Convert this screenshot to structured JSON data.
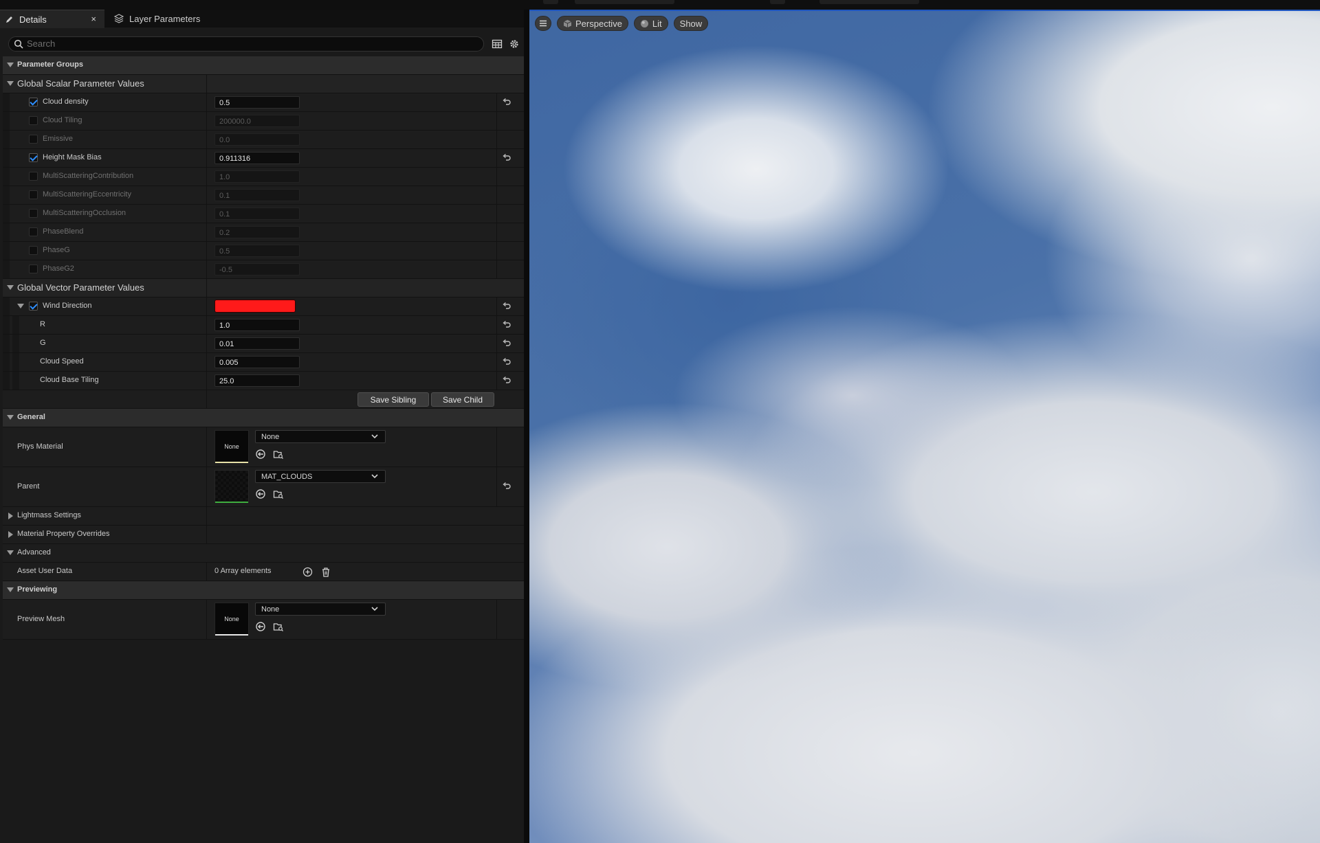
{
  "tabs": [
    {
      "label": "Details",
      "close": "×"
    },
    {
      "label": "Layer Parameters"
    }
  ],
  "search": {
    "placeholder": "Search"
  },
  "sections": {
    "parameter_groups": "Parameter Groups",
    "global_scalar": "Global Scalar Parameter Values",
    "global_vector": "Global Vector Parameter Values",
    "general": "General",
    "lightmass": "Lightmass Settings",
    "material_overrides": "Material Property Overrides",
    "advanced": "Advanced",
    "previewing": "Previewing"
  },
  "scalar_params": [
    {
      "label": "Cloud density",
      "value": "0.5",
      "enabled": true
    },
    {
      "label": "Cloud Tiling",
      "value": "200000.0",
      "enabled": false
    },
    {
      "label": "Emissive",
      "value": "0.0",
      "enabled": false
    },
    {
      "label": "Height Mask Bias",
      "value": "0.911316",
      "enabled": true
    },
    {
      "label": "MultiScatteringContribution",
      "value": "1.0",
      "enabled": false
    },
    {
      "label": "MultiScatteringEccentricity",
      "value": "0.1",
      "enabled": false
    },
    {
      "label": "MultiScatteringOcclusion",
      "value": "0.1",
      "enabled": false
    },
    {
      "label": "PhaseBlend",
      "value": "0.2",
      "enabled": false
    },
    {
      "label": "PhaseG",
      "value": "0.5",
      "enabled": false
    },
    {
      "label": "PhaseG2",
      "value": "-0.5",
      "enabled": false
    }
  ],
  "vector_param": {
    "label": "Wind Direction",
    "color": "#ff1a1a",
    "components": [
      {
        "label": "R",
        "value": "1.0"
      },
      {
        "label": "G",
        "value": "0.01"
      },
      {
        "label": "Cloud Speed",
        "value": "0.005"
      },
      {
        "label": "Cloud Base Tiling",
        "value": "25.0"
      }
    ]
  },
  "buttons": {
    "save_sibling": "Save Sibling",
    "save_child": "Save Child"
  },
  "general": {
    "phys_material": {
      "label": "Phys Material",
      "thumb": "None",
      "value": "None"
    },
    "parent": {
      "label": "Parent",
      "value": "MAT_CLOUDS"
    }
  },
  "advanced": {
    "asset_user_data": {
      "label": "Asset User Data",
      "value": "0 Array elements"
    }
  },
  "previewing": {
    "preview_mesh": {
      "label": "Preview Mesh",
      "thumb": "None",
      "value": "None"
    }
  },
  "viewport": {
    "perspective": "Perspective",
    "lit": "Lit",
    "show": "Show"
  },
  "colors": {
    "accent": "#2e8fff",
    "viewport_border": "#1f56c0",
    "parent_underline": "#3fae3f",
    "phys_underline": "#e8e2a8"
  }
}
